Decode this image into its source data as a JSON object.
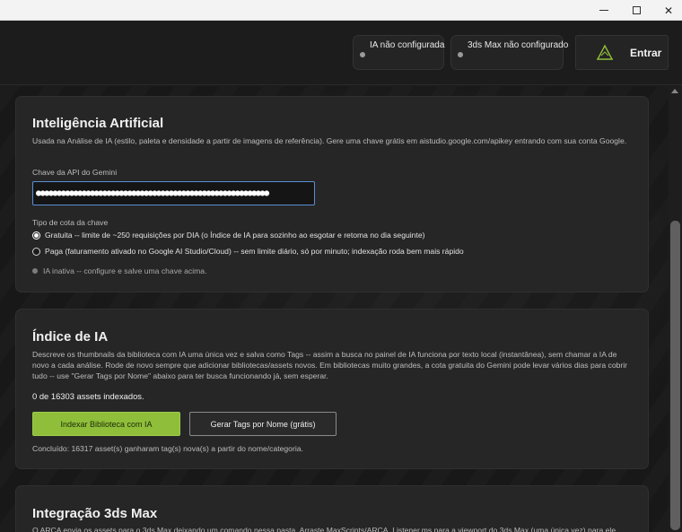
{
  "window": {
    "minimize_glyph": "",
    "maximize_glyph": "",
    "close_glyph": "✕"
  },
  "header": {
    "status_ia": "IA não configurada",
    "status_max": "3ds Max não configurado",
    "login_label": "Entrar",
    "logo_color": "#8fbf3a"
  },
  "ai_section": {
    "title": "Inteligência Artificial",
    "description": "Usada na Análise de IA (estilo, paleta e densidade a partir de imagens de referência). Gere uma chave grátis em aistudio.google.com/apikey entrando com sua conta Google.",
    "api_key_label": "Chave da API do Gemini",
    "api_key_value": "●●●●●●●●●●●●●●●●●●●●●●●●●●●●●●●●●●●●●●●●●●●●●●●●●●●●●●●●",
    "quota_label": "Tipo de cota da chave",
    "quota_options": [
      {
        "label": "Gratuita -- limite de ~250 requisições por DIA (o Índice de IA para sozinho ao esgotar e retoma no dia seguinte)",
        "selected": true
      },
      {
        "label": "Paga (faturamento ativado no Google AI Studio/Cloud) -- sem limite diário, só por minuto; indexação roda bem mais rápido",
        "selected": false
      }
    ],
    "status_text": "IA inativa -- configure e salve uma chave acima."
  },
  "index_section": {
    "title": "Índice de IA",
    "description": "Descreve os thumbnails da biblioteca com IA uma única vez e salva como Tags -- assim a busca no painel de IA funciona por texto local (instantânea), sem chamar a IA de novo a cada análise. Rode de novo sempre que adicionar bibliotecas/assets novos. Em bibliotecas muito grandes, a cota gratuita do Gemini pode levar vários dias para cobrir tudo -- use \"Gerar Tags por Nome\" abaixo para ter busca funcionando já, sem esperar.",
    "count_text": "0 de 16303 assets indexados.",
    "index_button": "Indexar Biblioteca com IA",
    "tags_button": "Gerar Tags por Nome (grátis)",
    "result_text": "Concluído: 16317 asset(s) ganharam tag(s) nova(s) a partir do nome/categoria."
  },
  "max_section": {
    "title": "Integração 3ds Max",
    "description": "O ARCA envia os assets para o 3ds Max deixando um comando nessa pasta. Arraste MaxScripts/ARCA_Listener.ms para a viewport do 3ds Max (uma única vez) para ele"
  },
  "colors": {
    "accent_green": "#8fbf3a",
    "input_focus": "#5b8fd6"
  }
}
